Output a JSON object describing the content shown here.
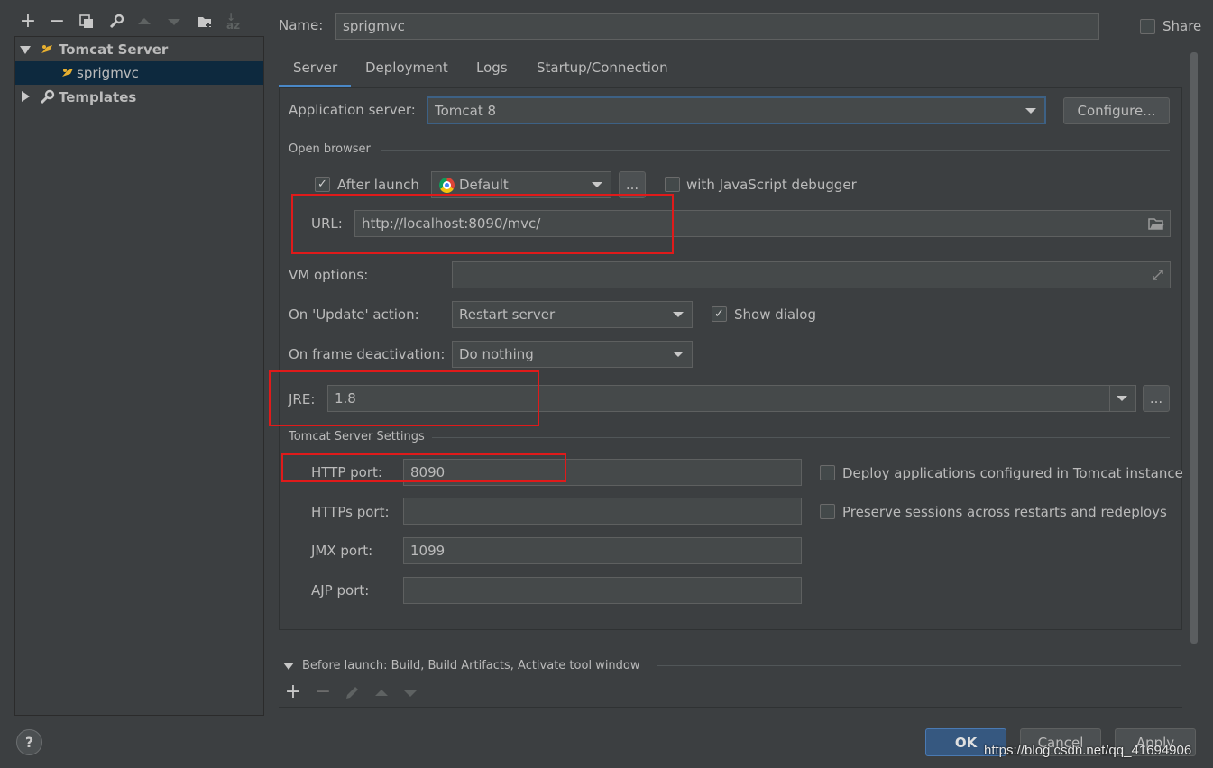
{
  "toolbar": {
    "icons": [
      "add-icon",
      "remove-icon",
      "copy-icon",
      "wrench-icon",
      "move-up-icon",
      "move-down-icon",
      "new-folder-icon",
      "sort-icon"
    ]
  },
  "tree": {
    "items": [
      {
        "label": "Tomcat Server",
        "expanded": true
      },
      {
        "label": "sprigmvc",
        "selected": true
      },
      {
        "label": "Templates",
        "expanded": false
      }
    ]
  },
  "header": {
    "name_label": "Name:",
    "name_value": "sprigmvc",
    "share_label": "Share"
  },
  "tabs": [
    {
      "label": "Server",
      "active": true
    },
    {
      "label": "Deployment"
    },
    {
      "label": "Logs"
    },
    {
      "label": "Startup/Connection"
    }
  ],
  "server": {
    "app_server_label": "Application server:",
    "app_server_value": "Tomcat 8",
    "configure_label": "Configure...",
    "open_browser_title": "Open browser",
    "after_launch_label": "After launch",
    "after_launch_checked": true,
    "browser_value": "Default",
    "browser_more": "...",
    "js_debugger_label": "with JavaScript debugger",
    "url_label": "URL:",
    "url_value": "http://localhost:8090/mvc/",
    "vm_label": "VM options:",
    "vm_value": "",
    "update_label": "On 'Update' action:",
    "update_value": "Restart server",
    "show_dialog_label": "Show dialog",
    "show_dialog_checked": true,
    "frame_label": "On frame deactivation:",
    "frame_value": "Do nothing",
    "jre_label": "JRE:",
    "jre_value": "1.8",
    "jre_more": "...",
    "tomcat_settings_title": "Tomcat Server Settings",
    "http_label": "HTTP port:",
    "http_value": "8090",
    "https_label": "HTTPs port:",
    "https_value": "",
    "jmx_label": "JMX port:",
    "jmx_value": "1099",
    "ajp_label": "AJP port:",
    "ajp_value": "",
    "deploy_label": "Deploy applications configured in Tomcat instance",
    "preserve_label": "Preserve sessions across restarts and redeploys"
  },
  "before_launch": {
    "title": "Before launch: Build, Build Artifacts, Activate tool window"
  },
  "footer": {
    "help": "?",
    "ok": "OK",
    "cancel": "Cancel",
    "apply": "Apply",
    "watermark": "https://blog.csdn.net/qq_41694906"
  },
  "colors": {
    "background": "#3c3f41",
    "selection": "#0d293e",
    "highlight_box": "#e01a1a",
    "ok_button": "#365880"
  }
}
